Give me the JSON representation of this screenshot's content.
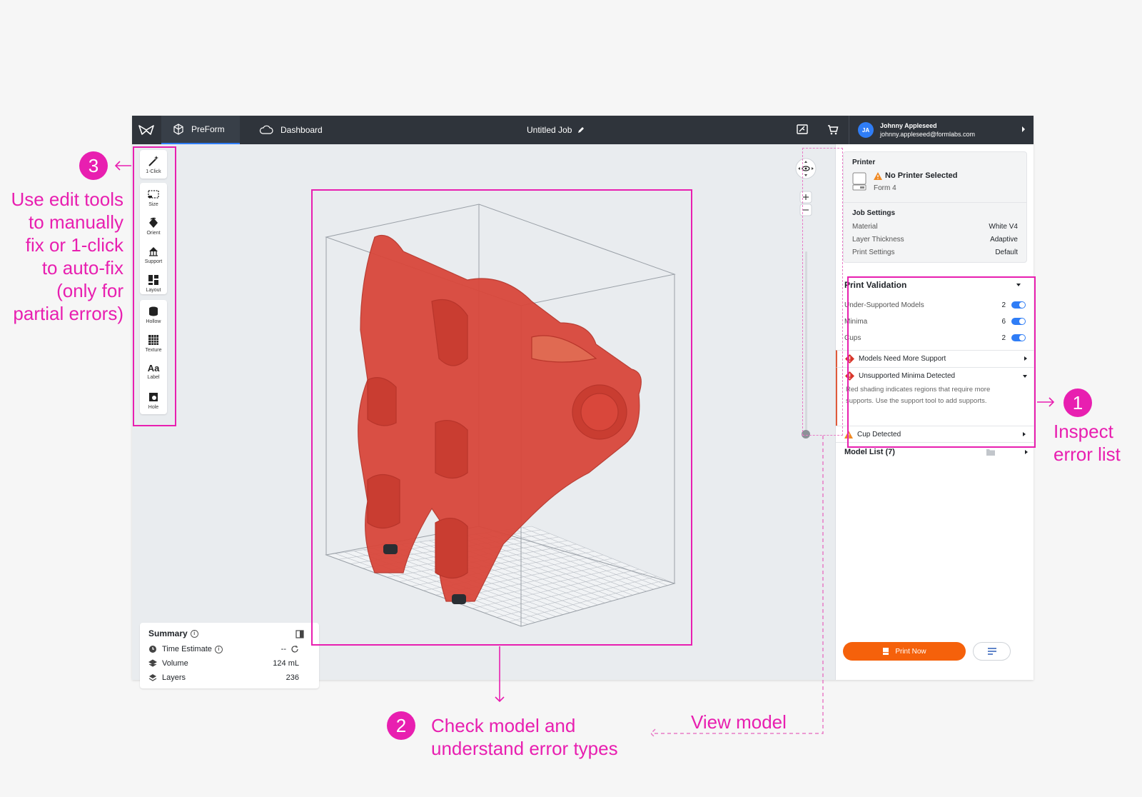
{
  "app": {
    "tabs": [
      {
        "label": "PreForm"
      },
      {
        "label": "Dashboard"
      }
    ],
    "job_title": "Untitled Job",
    "user": {
      "initials": "JA",
      "name": "Johnny Appleseed",
      "email": "johnny.appleseed@formlabs.com"
    }
  },
  "tools": [
    {
      "label": "1-Click",
      "icon": "magic-wand-icon"
    },
    {
      "label": "Size",
      "icon": "size-icon"
    },
    {
      "label": "Orient",
      "icon": "orient-icon"
    },
    {
      "label": "Support",
      "icon": "support-icon"
    },
    {
      "label": "Layout",
      "icon": "layout-icon"
    },
    {
      "label": "Hollow",
      "icon": "hollow-icon"
    },
    {
      "label": "Texture",
      "icon": "texture-icon"
    },
    {
      "label": "Label",
      "icon": "label-icon",
      "glyph": "Aa"
    },
    {
      "label": "Hole",
      "icon": "hole-icon"
    }
  ],
  "summary": {
    "title": "Summary",
    "rows": [
      {
        "label": "Time Estimate",
        "value": "--"
      },
      {
        "label": "Volume",
        "value": "124 mL"
      },
      {
        "label": "Layers",
        "value": "236"
      }
    ]
  },
  "printer": {
    "heading": "Printer",
    "status": "No Printer Selected",
    "model": "Form 4"
  },
  "job_settings": {
    "heading": "Job Settings",
    "rows": [
      {
        "label": "Material",
        "value": "White V4"
      },
      {
        "label": "Layer Thickness",
        "value": "Adaptive"
      },
      {
        "label": "Print Settings",
        "value": "Default"
      }
    ]
  },
  "validation": {
    "title": "Print Validation",
    "rows": [
      {
        "label": "Under-Supported Models",
        "count": "2"
      },
      {
        "label": "Minima",
        "count": "6"
      },
      {
        "label": "Cups",
        "count": "2"
      }
    ],
    "errors": [
      {
        "label": "Models Need More Support"
      },
      {
        "label": "Unsupported Minima Detected",
        "description": "Red shading indicates regions that require more supports. Use the support tool to add supports."
      },
      {
        "label": "Cup Detected"
      }
    ]
  },
  "model_list": "Model List (7)",
  "print_now": "Print Now",
  "annotations": {
    "step1_num": "1",
    "step1_text": "Inspect error list",
    "step2_num": "2",
    "step2_text": "Check model and understand error types",
    "step3_num": "3",
    "step3_text": "Use edit tools to manually fix or 1-click to auto-fix (only for partial errors)",
    "view_model": "View model"
  },
  "colors": {
    "accent": "#e81fb0",
    "primary_blue": "#2f7df6",
    "print_orange": "#f5610b",
    "model_red": "#d9473b",
    "topbar": "#2f343b"
  }
}
